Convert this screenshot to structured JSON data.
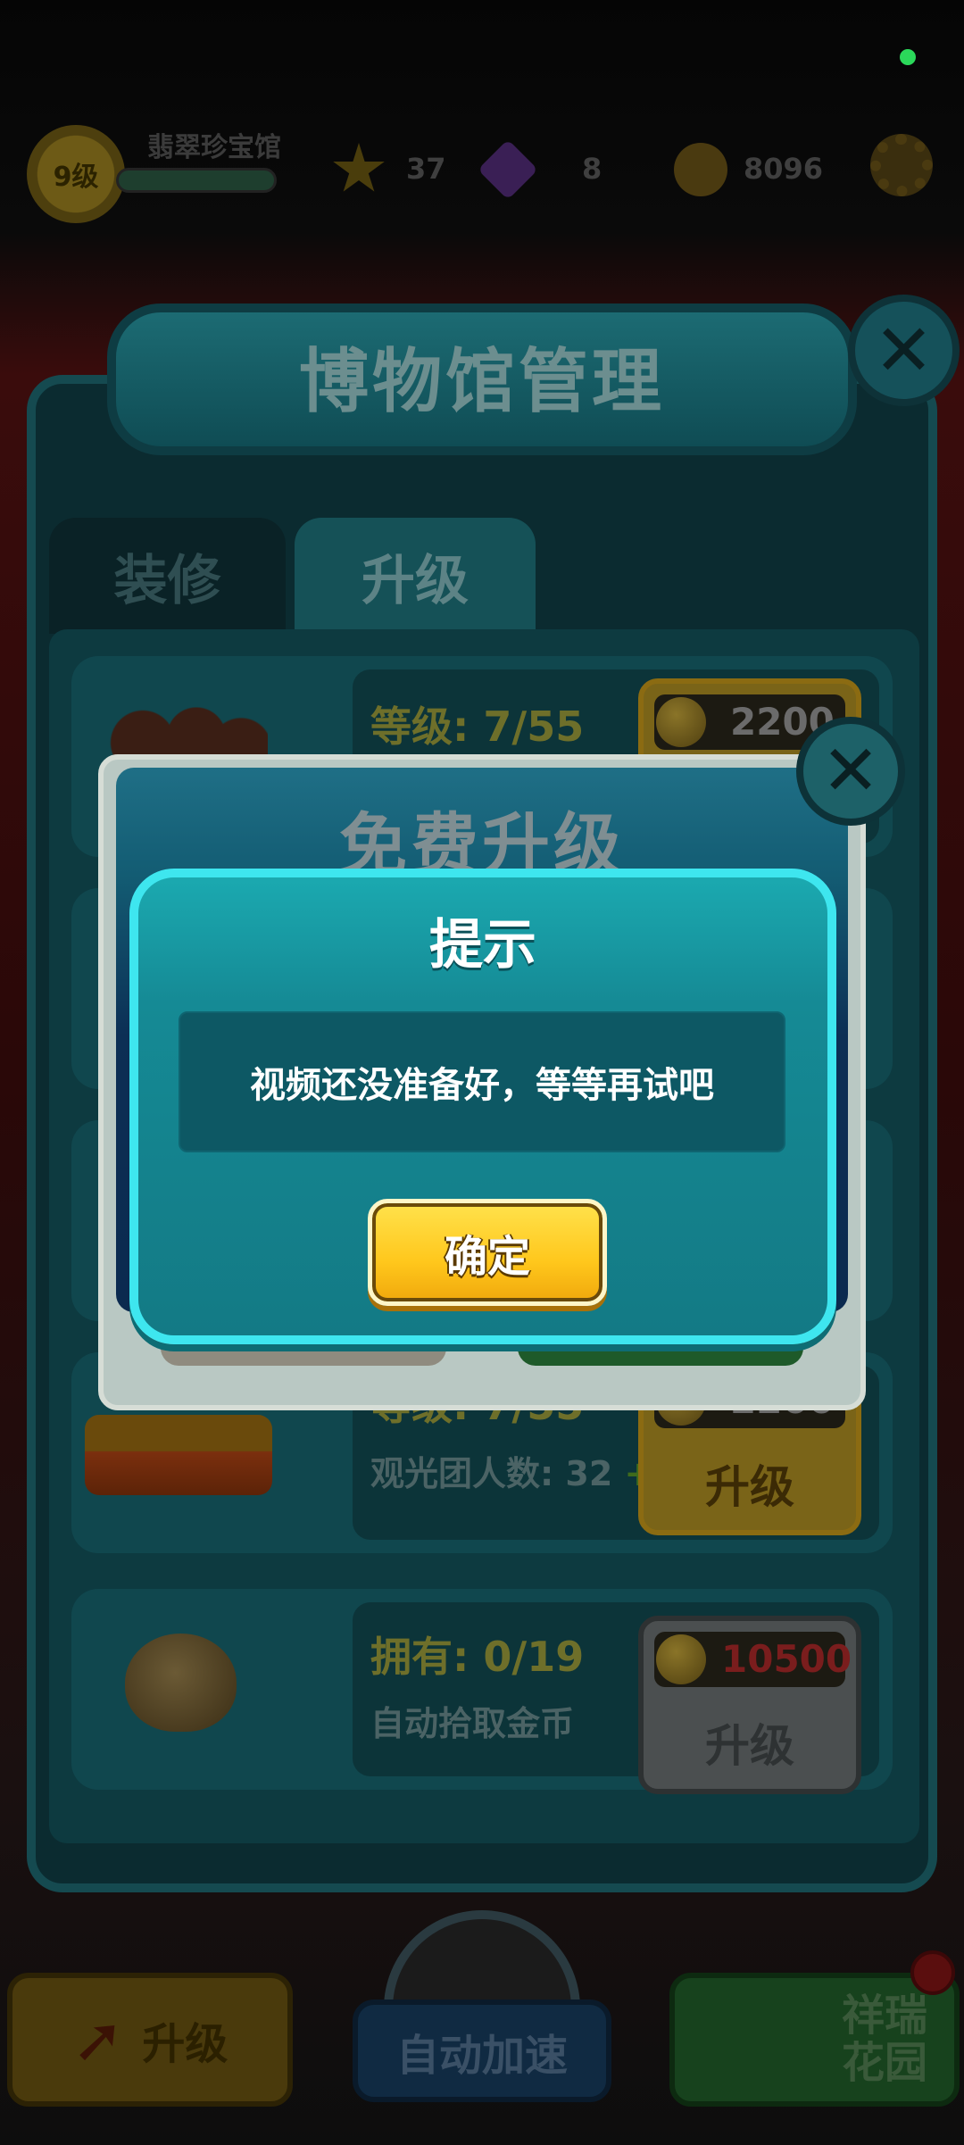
{
  "hud": {
    "level": "9级",
    "museum_name": "翡翠珍宝馆",
    "stars": "37",
    "gems": "8",
    "coins": "8096"
  },
  "panel": {
    "title": "博物馆管理",
    "tabs": [
      "装修",
      "升级"
    ],
    "items": [
      {
        "line1": "等级: 7/55",
        "price": "2200"
      },
      {
        "line1": "等级: 7/55",
        "line2": "观光团人数: 32",
        "plus": "+2",
        "price": "2200",
        "button": "升级"
      },
      {
        "line1": "拥有: 0/19",
        "line2": "自动拾取金币",
        "price": "10500",
        "button": "升级"
      }
    ]
  },
  "bottom": {
    "upgrade": "升级",
    "auto_speed": "自动加速",
    "garden_line1": "祥瑞",
    "garden_line2": "花园"
  },
  "free_dialog": {
    "title": "免费升级"
  },
  "prompt": {
    "title": "提示",
    "message": "视频还没准备好，等等再试吧",
    "ok": "确定"
  },
  "colors": {
    "prompt_bg": "#158a95",
    "prompt_border": "#3ee6ef",
    "ok_button": "#ffc71c"
  }
}
